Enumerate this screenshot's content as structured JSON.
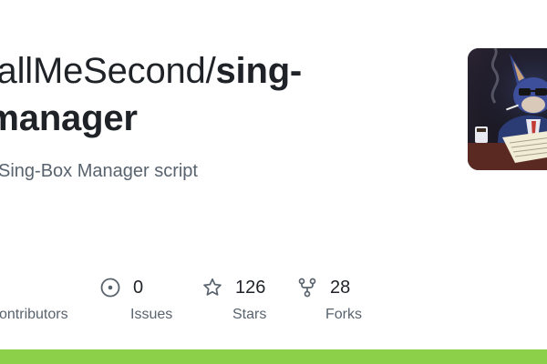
{
  "repo": {
    "owner": "eyCallMeSecond/",
    "name_line1": "sing-",
    "name_line2": "ox-manager",
    "description": "Sing-Box Manager script"
  },
  "stats": [
    {
      "key": "contributors",
      "value": "",
      "label": "ontributors",
      "icon": "people-icon"
    },
    {
      "key": "issues",
      "value": "0",
      "label": "Issues",
      "icon": "issue-circle-icon"
    },
    {
      "key": "stars",
      "value": "126",
      "label": "Stars",
      "icon": "star-icon"
    },
    {
      "key": "forks",
      "value": "28",
      "label": "Forks",
      "icon": "fork-icon"
    }
  ],
  "colors": {
    "accent_bar": "#8cd04a",
    "text_primary": "#1f2328",
    "text_muted": "#59636e"
  }
}
